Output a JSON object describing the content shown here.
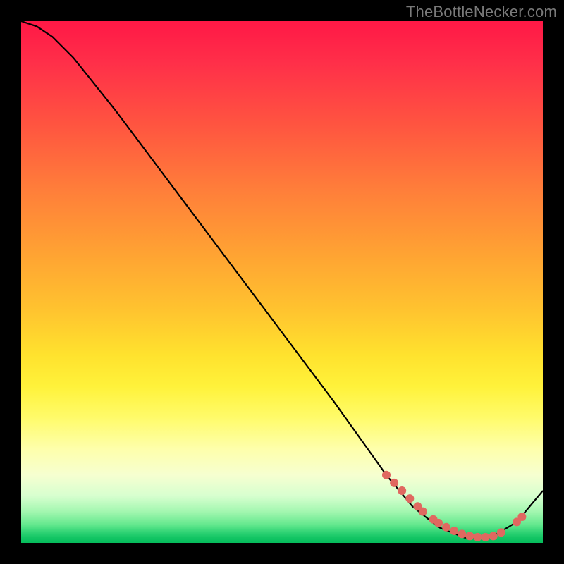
{
  "watermark": "TheBottleNecker.com",
  "chart_data": {
    "type": "line",
    "title": "",
    "xlabel": "",
    "ylabel": "",
    "xlim": [
      0,
      100
    ],
    "ylim": [
      0,
      100
    ],
    "series": [
      {
        "name": "curve",
        "color": "#000000",
        "x": [
          0,
          3,
          6,
          10,
          18,
          30,
          45,
          60,
          70,
          75,
          80,
          85,
          90,
          95,
          100
        ],
        "y": [
          100,
          99,
          97,
          93,
          83,
          67,
          47,
          27,
          13,
          7,
          3,
          1,
          1,
          4,
          10
        ]
      }
    ],
    "markers": {
      "name": "highlight-dots",
      "color": "#e06860",
      "radius": 6,
      "points": [
        {
          "x": 70,
          "y": 13
        },
        {
          "x": 71.5,
          "y": 11.5
        },
        {
          "x": 73,
          "y": 10
        },
        {
          "x": 74.5,
          "y": 8.5
        },
        {
          "x": 76,
          "y": 7
        },
        {
          "x": 77,
          "y": 6
        },
        {
          "x": 79,
          "y": 4.5
        },
        {
          "x": 80,
          "y": 3.8
        },
        {
          "x": 81.5,
          "y": 3
        },
        {
          "x": 83,
          "y": 2.3
        },
        {
          "x": 84.5,
          "y": 1.7
        },
        {
          "x": 86,
          "y": 1.3
        },
        {
          "x": 87.5,
          "y": 1.1
        },
        {
          "x": 89,
          "y": 1.1
        },
        {
          "x": 90.5,
          "y": 1.3
        },
        {
          "x": 92,
          "y": 2
        },
        {
          "x": 95,
          "y": 4
        },
        {
          "x": 96,
          "y": 5
        }
      ]
    },
    "background_gradient": {
      "stops": [
        {
          "pos": 0.0,
          "color": "#ff1846"
        },
        {
          "pos": 0.55,
          "color": "#ffc22f"
        },
        {
          "pos": 0.8,
          "color": "#fffb6a"
        },
        {
          "pos": 1.0,
          "color": "#06bd5c"
        }
      ]
    }
  }
}
